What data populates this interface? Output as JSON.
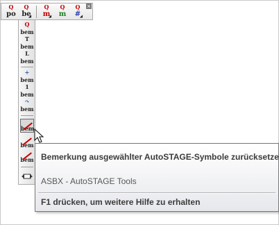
{
  "toolbar": {
    "buttons": [
      {
        "main": "po",
        "sup": "Q",
        "color": "#222222"
      },
      {
        "main": "be",
        "sup": "Q",
        "color": "#222222"
      },
      {
        "main": "m",
        "sup": "Q",
        "color": "#c00000"
      },
      {
        "main": "m",
        "sup": "Q",
        "color": "#1f7f1f"
      },
      {
        "main": "#",
        "sup": "Q",
        "color": "#2b3fb0"
      }
    ],
    "close": "×"
  },
  "vtoolbar": {
    "buttons": [
      {
        "sup": "Q",
        "main": "bem"
      },
      {
        "sup": "T",
        "main": "bem"
      },
      {
        "sup": "L",
        "main": "bem"
      },
      {
        "sup": "+",
        "main": "bem"
      },
      {
        "sup": "1",
        "main": "bem"
      },
      {
        "sup": "↷",
        "main": "bem"
      },
      {
        "sup": "",
        "main": "bem"
      },
      {
        "sup": "",
        "main": "bem"
      },
      {
        "sup": "",
        "main": "bem"
      }
    ]
  },
  "tooltip": {
    "title": "Bemerkung ausgewählter AutoSTAGE-Symbole zurücksetzen",
    "body": "ASBX - AutoSTAGE Tools",
    "help": "F1 drücken, um weitere Hilfe zu erhalten"
  }
}
